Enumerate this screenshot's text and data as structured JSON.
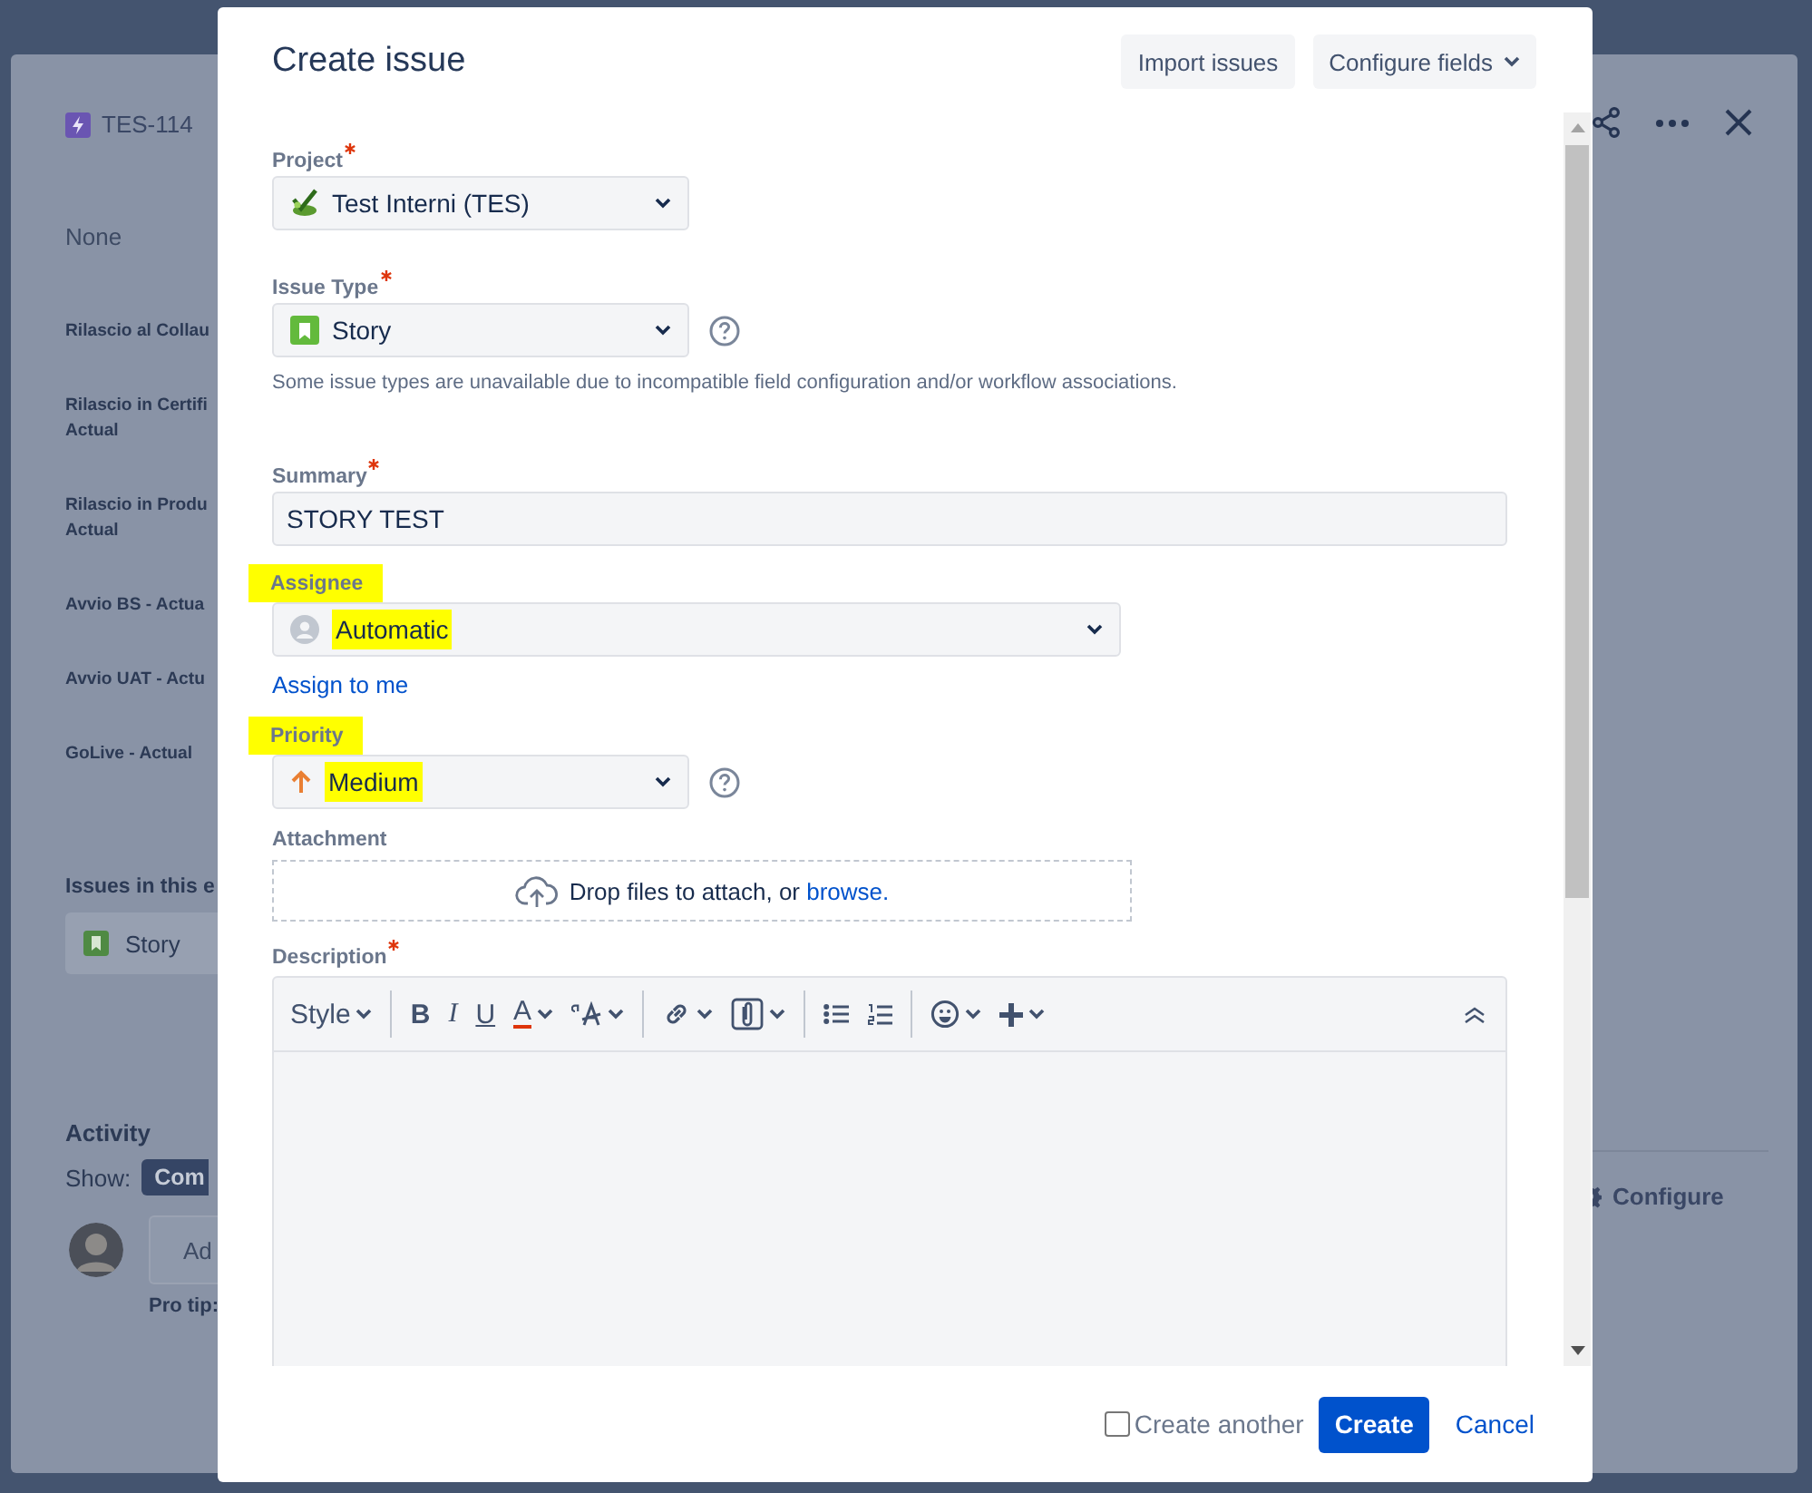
{
  "backdrop": {
    "issue_key": "TES-114",
    "empty_value": "None",
    "date_fields": [
      {
        "lines": [
          "Rilascio al Collau"
        ]
      },
      {
        "lines": [
          "Rilascio in Certifi",
          "Actual"
        ]
      },
      {
        "lines": [
          "Rilascio in Produ",
          "Actual"
        ]
      },
      {
        "lines": [
          "Avvio BS - Actua"
        ]
      },
      {
        "lines": [
          "Avvio UAT - Actu"
        ]
      },
      {
        "lines": [
          "GoLive - Actual"
        ]
      }
    ],
    "issues_heading": "Issues in this e",
    "child_issue": "Story",
    "activity": "Activity",
    "show_label": "Show:",
    "show_filter": "Com",
    "comment_field": {
      "placeholder": "Ad"
    },
    "pro_tip": "Pro tip:",
    "configure": "Configure"
  },
  "dialog": {
    "title": "Create issue",
    "header_buttons": [
      {
        "label": "Import issues",
        "dropdown": false
      },
      {
        "label": "Configure fields",
        "dropdown": true
      }
    ],
    "fields": [
      {
        "kind": "select",
        "label": "Project",
        "required": true,
        "highlighted": false,
        "value": "Test Interni (TES)",
        "help": false
      },
      {
        "kind": "select",
        "label": "Issue Type",
        "required": true,
        "highlighted": false,
        "value": "Story",
        "help": true,
        "note": "Some issue types are unavailable due to incompatible field configuration and/or workflow associations."
      },
      {
        "kind": "divider"
      },
      {
        "kind": "text",
        "label": "Summary",
        "required": true,
        "highlighted": false,
        "value": "STORY TEST"
      },
      {
        "kind": "select",
        "label": "Assignee",
        "required": false,
        "highlighted": true,
        "value": "Automatic",
        "help": false,
        "link": "Assign to me"
      },
      {
        "kind": "select",
        "label": "Priority",
        "required": false,
        "highlighted": true,
        "value": "Medium",
        "help": true
      },
      {
        "kind": "attachment",
        "label": "Attachment",
        "required": false,
        "highlighted": false,
        "prompt": "Drop files to attach, or",
        "link": "browse."
      },
      {
        "kind": "editor",
        "label": "Description",
        "required": true,
        "highlighted": false,
        "toolbar": [
          {
            "kind": "style",
            "label": "Style",
            "menu": true
          },
          {
            "kind": "separator"
          },
          {
            "kind": "bold",
            "label": "B",
            "menu": false
          },
          {
            "kind": "italic",
            "label": "I",
            "menu": false
          },
          {
            "kind": "underline",
            "label": "U",
            "menu": false
          },
          {
            "kind": "text-color",
            "label": "A",
            "menu": true
          },
          {
            "kind": "text-size",
            "menu": true
          },
          {
            "kind": "separator"
          },
          {
            "kind": "link",
            "menu": true
          },
          {
            "kind": "attachment",
            "menu": true
          },
          {
            "kind": "separator"
          },
          {
            "kind": "bullet-list",
            "menu": false
          },
          {
            "kind": "numbered-list",
            "menu": false
          },
          {
            "kind": "separator"
          },
          {
            "kind": "emoji",
            "menu": true
          },
          {
            "kind": "insert",
            "menu": true
          },
          {
            "kind": "collapse",
            "menu": false
          }
        ]
      }
    ],
    "create_another": {
      "label": "Create another",
      "checked": false
    },
    "primary_button": "Create",
    "cancel_link": "Cancel"
  }
}
